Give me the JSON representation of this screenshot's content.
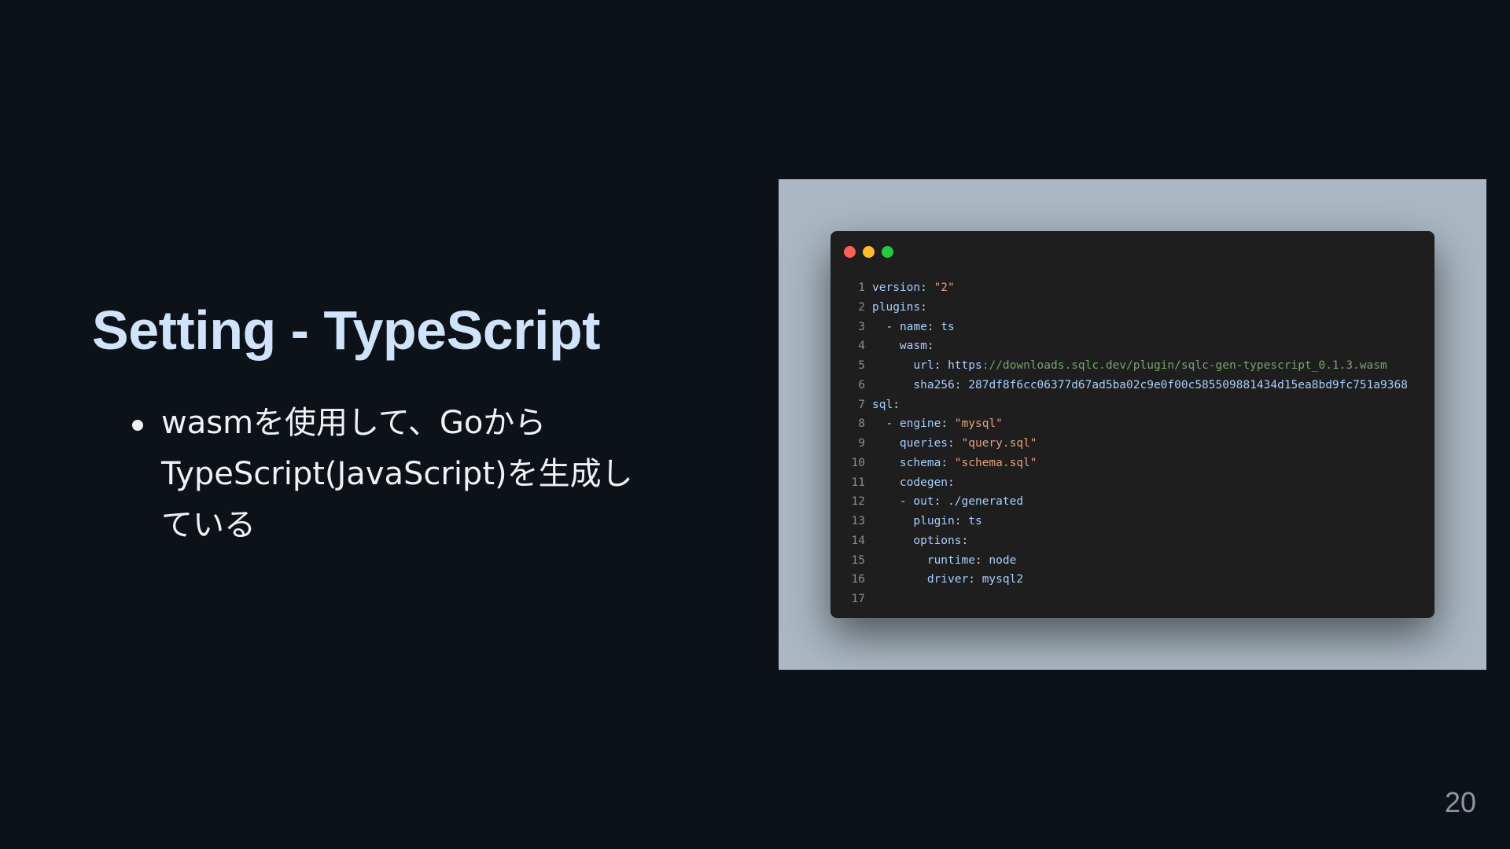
{
  "slide": {
    "title": "Setting - TypeScript",
    "bullets": [
      "wasmを使用して、GoからTypeScript(JavaScript)を生成している"
    ],
    "page_number": "20"
  },
  "code_window": {
    "lines": [
      {
        "num": "1",
        "indent": "",
        "tokens": [
          {
            "t": "version",
            "c": "key"
          },
          {
            "t": ": ",
            "c": "punc"
          },
          {
            "t": "\"2\"",
            "c": "str"
          }
        ]
      },
      {
        "num": "2",
        "indent": "",
        "tokens": [
          {
            "t": "plugins",
            "c": "key"
          },
          {
            "t": ":",
            "c": "punc"
          }
        ]
      },
      {
        "num": "3",
        "indent": "  ",
        "tokens": [
          {
            "t": "- ",
            "c": "punc"
          },
          {
            "t": "name",
            "c": "key"
          },
          {
            "t": ": ",
            "c": "punc"
          },
          {
            "t": "ts",
            "c": "plain"
          }
        ]
      },
      {
        "num": "4",
        "indent": "    ",
        "tokens": [
          {
            "t": "wasm",
            "c": "key"
          },
          {
            "t": ":",
            "c": "punc"
          }
        ]
      },
      {
        "num": "5",
        "indent": "      ",
        "tokens": [
          {
            "t": "url",
            "c": "key"
          },
          {
            "t": ": ",
            "c": "punc"
          },
          {
            "t": "https",
            "c": "plain"
          },
          {
            "t": "://downloads.sqlc.dev/plugin/sqlc-gen-typescript_0.1.3.wasm",
            "c": "url"
          }
        ]
      },
      {
        "num": "6",
        "indent": "      ",
        "tokens": [
          {
            "t": "sha256",
            "c": "key"
          },
          {
            "t": ": ",
            "c": "punc"
          },
          {
            "t": "287df8f6cc06377d67ad5ba02c9e0f00c585509881434d15ea8bd9fc751a9368",
            "c": "plain"
          }
        ]
      },
      {
        "num": "7",
        "indent": "",
        "tokens": [
          {
            "t": "sql",
            "c": "key"
          },
          {
            "t": ":",
            "c": "punc"
          }
        ]
      },
      {
        "num": "8",
        "indent": "  ",
        "tokens": [
          {
            "t": "- ",
            "c": "punc"
          },
          {
            "t": "engine",
            "c": "key"
          },
          {
            "t": ": ",
            "c": "punc"
          },
          {
            "t": "\"mysql\"",
            "c": "str"
          }
        ]
      },
      {
        "num": "9",
        "indent": "    ",
        "tokens": [
          {
            "t": "queries",
            "c": "key"
          },
          {
            "t": ": ",
            "c": "punc"
          },
          {
            "t": "\"query.sql\"",
            "c": "str"
          }
        ]
      },
      {
        "num": "10",
        "indent": "    ",
        "tokens": [
          {
            "t": "schema",
            "c": "key"
          },
          {
            "t": ": ",
            "c": "punc"
          },
          {
            "t": "\"schema.sql\"",
            "c": "str"
          }
        ]
      },
      {
        "num": "11",
        "indent": "    ",
        "tokens": [
          {
            "t": "codegen",
            "c": "key"
          },
          {
            "t": ":",
            "c": "punc"
          }
        ]
      },
      {
        "num": "12",
        "indent": "    ",
        "tokens": [
          {
            "t": "- ",
            "c": "punc"
          },
          {
            "t": "out",
            "c": "key"
          },
          {
            "t": ": ",
            "c": "punc"
          },
          {
            "t": "./generated",
            "c": "plain"
          }
        ]
      },
      {
        "num": "13",
        "indent": "      ",
        "tokens": [
          {
            "t": "plugin",
            "c": "key"
          },
          {
            "t": ": ",
            "c": "punc"
          },
          {
            "t": "ts",
            "c": "plain"
          }
        ]
      },
      {
        "num": "14",
        "indent": "      ",
        "tokens": [
          {
            "t": "options",
            "c": "key"
          },
          {
            "t": ":",
            "c": "punc"
          }
        ]
      },
      {
        "num": "15",
        "indent": "        ",
        "tokens": [
          {
            "t": "runtime",
            "c": "key"
          },
          {
            "t": ": ",
            "c": "punc"
          },
          {
            "t": "node",
            "c": "plain"
          }
        ]
      },
      {
        "num": "16",
        "indent": "        ",
        "tokens": [
          {
            "t": "driver",
            "c": "key"
          },
          {
            "t": ": ",
            "c": "punc"
          },
          {
            "t": "mysql2",
            "c": "plain"
          }
        ]
      },
      {
        "num": "17",
        "indent": "",
        "tokens": []
      }
    ]
  },
  "colors": {
    "background": "#0d1118",
    "title": "#cfe3fb",
    "frame": "#abb8c3",
    "code_bg": "#1e1e1e",
    "key": "#a8cfff",
    "string": "#e6a17a",
    "url": "#74a56a"
  }
}
